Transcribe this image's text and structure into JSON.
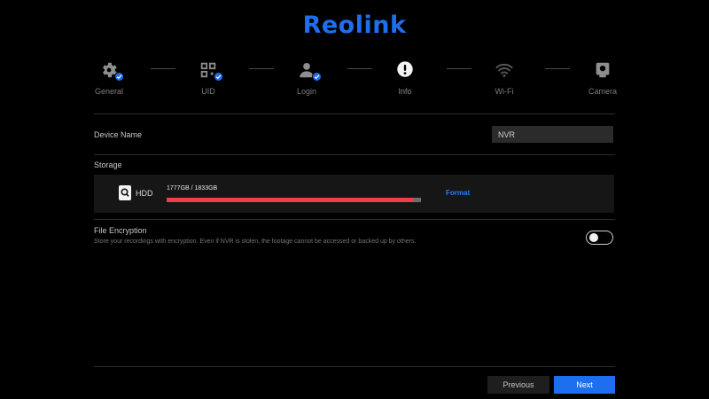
{
  "brand": {
    "logo_text": "Reolink",
    "accent_color": "#1e6ff0"
  },
  "wizard": {
    "steps": [
      {
        "label": "General",
        "icon": "gear-icon",
        "completed": true
      },
      {
        "label": "UID",
        "icon": "qr-code-icon",
        "completed": true
      },
      {
        "label": "Login",
        "icon": "user-icon",
        "completed": true
      },
      {
        "label": "Info",
        "icon": "exclamation-icon",
        "current": true
      },
      {
        "label": "Wi-Fi",
        "icon": "wifi-icon"
      },
      {
        "label": "Camera",
        "icon": "camera-icon"
      }
    ]
  },
  "device_name": {
    "label": "Device Name",
    "value": "NVR"
  },
  "storage": {
    "label": "Storage",
    "drive_label": "HDD",
    "capacity_text": "1777GB / 1833GB",
    "used_fraction": 0.969,
    "bar_color": "#ef3d4c",
    "format_label": "Format"
  },
  "encryption": {
    "label": "File Encryption",
    "description": "Store your recordings with encryption. Even if NVR is stolen, the footage cannot be accessed or backed up by others.",
    "enabled": false
  },
  "footer": {
    "previous_label": "Previous",
    "next_label": "Next"
  }
}
